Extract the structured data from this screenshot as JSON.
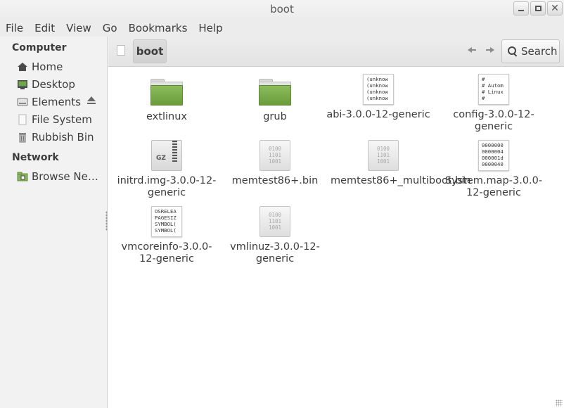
{
  "window": {
    "title": "boot"
  },
  "menubar": [
    "File",
    "Edit",
    "View",
    "Go",
    "Bookmarks",
    "Help"
  ],
  "sidebar": {
    "computer_heading": "Computer",
    "computer_items": [
      {
        "label": "Home",
        "icon": "home-icon"
      },
      {
        "label": "Desktop",
        "icon": "desktop-icon"
      },
      {
        "label": "Elements",
        "icon": "drive-icon",
        "ejectable": true
      },
      {
        "label": "File System",
        "icon": "filesystem-icon"
      },
      {
        "label": "Rubbish Bin",
        "icon": "trash-icon"
      }
    ],
    "network_heading": "Network",
    "network_items": [
      {
        "label": "Browse Net…",
        "icon": "network-icon"
      }
    ]
  },
  "toolbar": {
    "breadcrumb": "boot",
    "search_label": "Search"
  },
  "files": [
    {
      "name": "extlinux",
      "type": "folder"
    },
    {
      "name": "grub",
      "type": "folder"
    },
    {
      "name": "abi-3.0.0-12-generic",
      "type": "text",
      "preview": "(unknow\n(unknow\n(unknow\n(unknow"
    },
    {
      "name": "config-3.0.0-12-generic",
      "type": "text",
      "preview": "#\n# Autom\n# Linux\n#"
    },
    {
      "name": "initrd.img-3.0.0-12-generic",
      "type": "archive",
      "preview": "GZ"
    },
    {
      "name": "memtest86+.bin",
      "type": "binary",
      "preview": "0100\n1101\n1001"
    },
    {
      "name": "memtest86+_multiboot.bin",
      "type": "binary",
      "preview": "0100\n1101\n1001"
    },
    {
      "name": "System.map-3.0.0-12-generic",
      "type": "text",
      "preview": "0000000\n0000004\n000001d\n0000040"
    },
    {
      "name": "vmcoreinfo-3.0.0-12-generic",
      "type": "text",
      "preview": "OSRELEA\nPAGESIZ\nSYMBOL(\nSYMBOL("
    },
    {
      "name": "vmlinuz-3.0.0-12-generic",
      "type": "binary",
      "preview": "0100\n1101\n1001"
    }
  ]
}
